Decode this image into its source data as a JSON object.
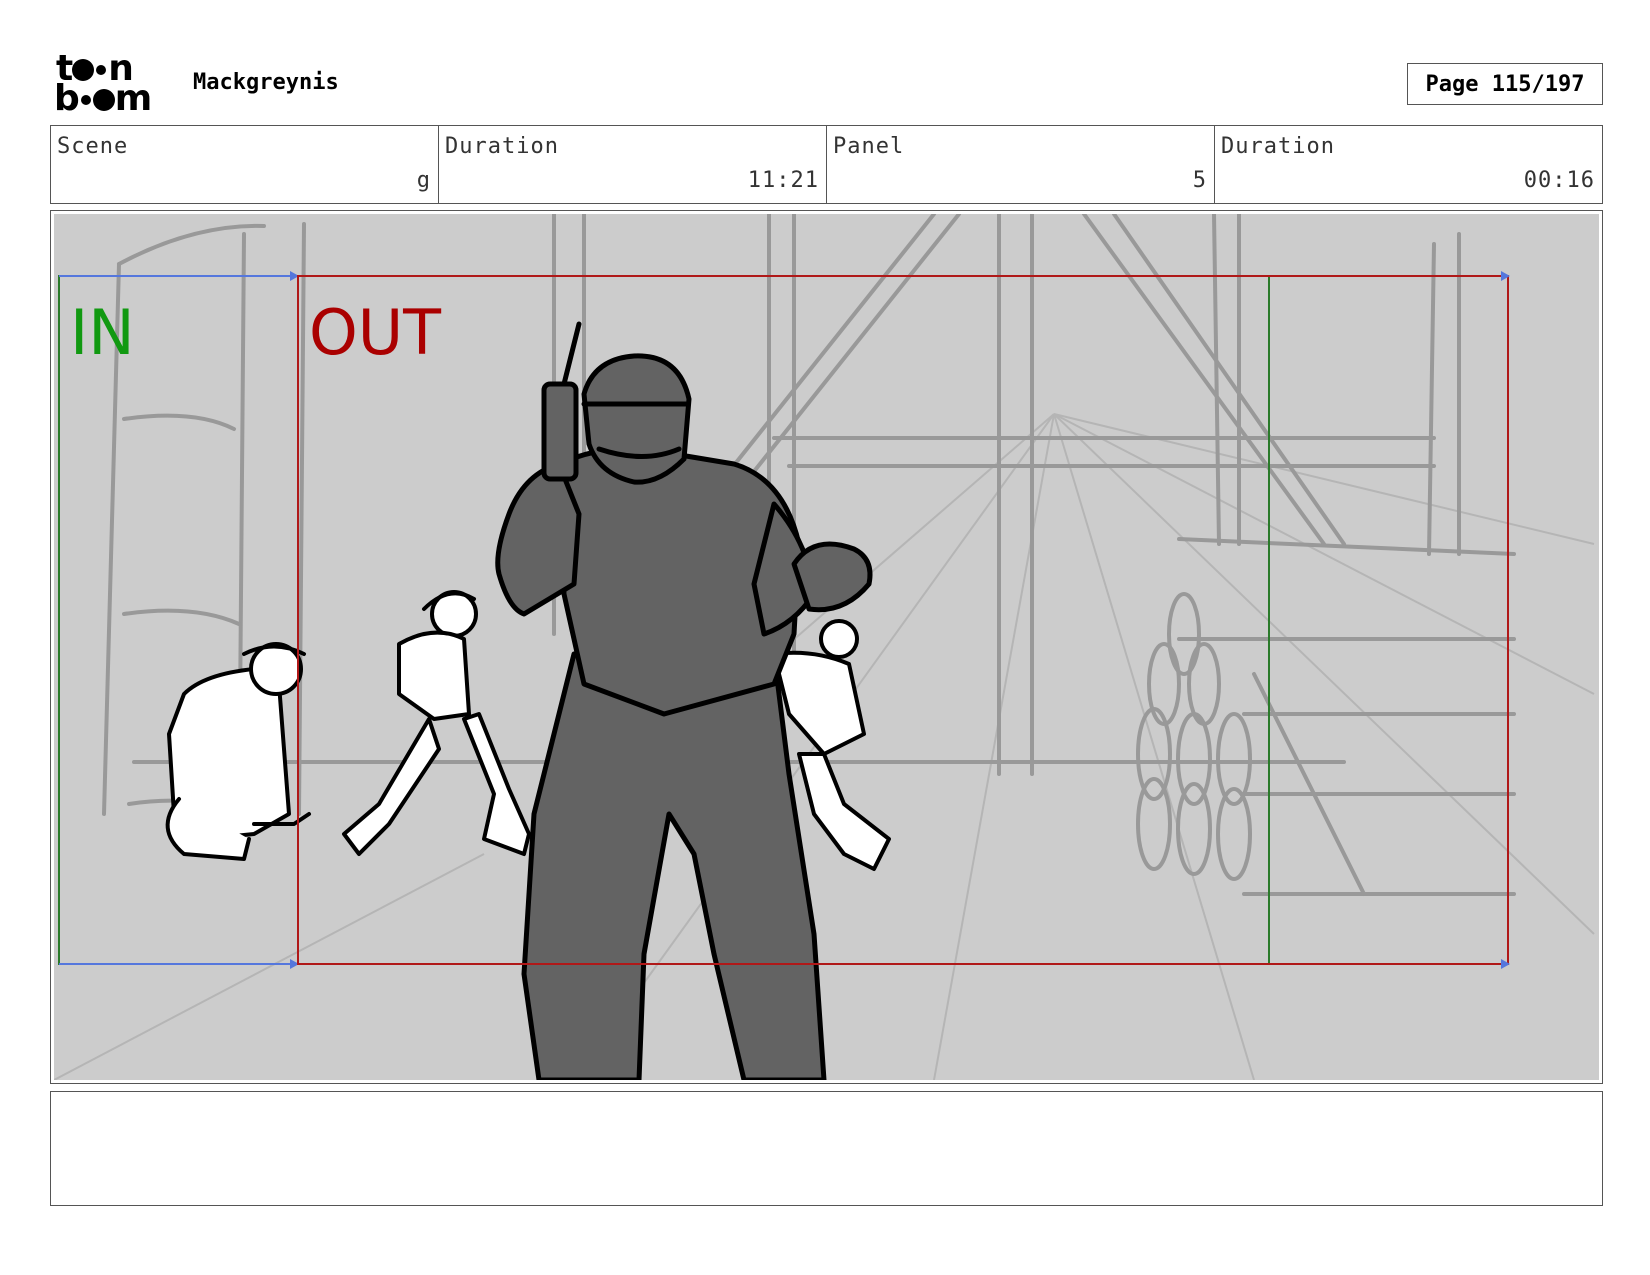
{
  "header": {
    "logo_line1": "t  n",
    "logo_line2": "b  m",
    "project_name": "Mackgreynis",
    "page_indicator": "Page 115/197"
  },
  "info": [
    {
      "label": "Scene",
      "value": "g"
    },
    {
      "label": "Duration",
      "value": "11:21"
    },
    {
      "label": "Panel",
      "value": "5"
    },
    {
      "label": "Duration",
      "value": "00:16"
    }
  ],
  "panel": {
    "in_label": "IN",
    "out_label": "OUT",
    "colors": {
      "background": "#cccccc",
      "in_frame": "#2a7a2a",
      "out_frame": "#b01818",
      "in_text": "#119911",
      "out_text": "#aa0000",
      "figure_fill": "#636363"
    }
  },
  "notes": ""
}
